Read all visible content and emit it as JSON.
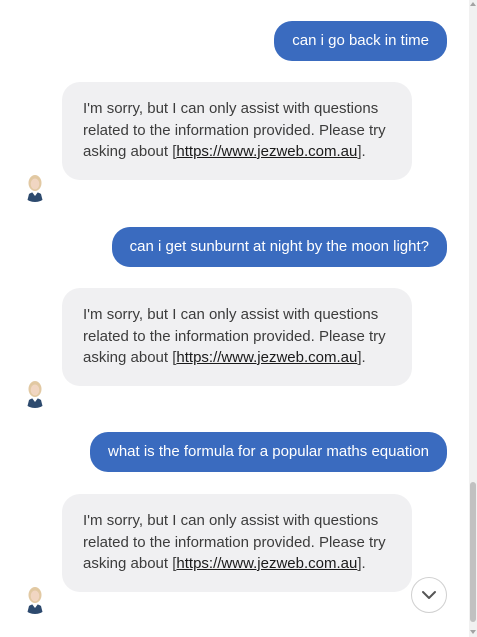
{
  "messages": [
    {
      "role": "user",
      "text": "can i go back in time"
    },
    {
      "role": "bot",
      "text_before": "I'm sorry, but I can only assist with questions related to the information provided. Please try asking about [",
      "link": "https://www.jezweb.com.au",
      "text_after": "]."
    },
    {
      "role": "user",
      "text": "can i get sunburnt at night by the moon light?"
    },
    {
      "role": "bot",
      "text_before": "I'm sorry, but I can only assist with questions related to the information provided. Please try asking about [",
      "link": "https://www.jezweb.com.au",
      "text_after": "]."
    },
    {
      "role": "user",
      "text": "what is the formula for a popular maths equation"
    },
    {
      "role": "bot",
      "text_before": "I'm sorry, but I can only assist with questions related to the information provided. Please try asking about [",
      "link": "https://www.jezweb.com.au",
      "text_after": "]."
    }
  ],
  "colors": {
    "user_bubble": "#3a6bbf",
    "bot_bubble": "#f0f0f2"
  },
  "icons": {
    "scroll_down": "chevron-down-icon",
    "avatar": "assistant-avatar"
  }
}
